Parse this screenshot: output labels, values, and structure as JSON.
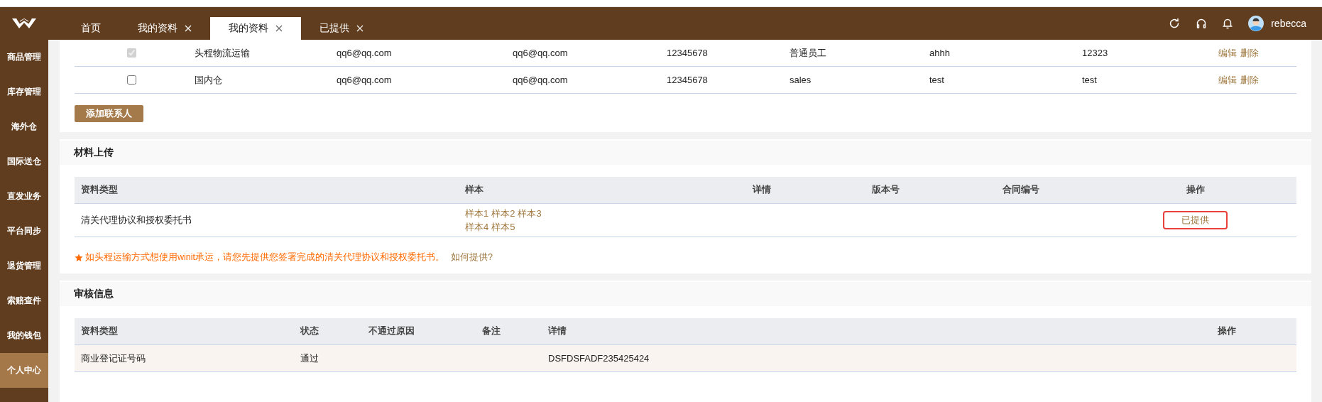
{
  "header": {
    "tabs": [
      {
        "label": "首页",
        "closable": false,
        "selected": false
      },
      {
        "label": "我的资料",
        "closable": true,
        "selected": false
      },
      {
        "label": "我的资料",
        "closable": true,
        "selected": true
      },
      {
        "label": "已提供",
        "closable": true,
        "selected": false
      }
    ],
    "username": "rebecca"
  },
  "sidebar": {
    "items": [
      {
        "label": "商品管理",
        "selected": false
      },
      {
        "label": "库存管理",
        "selected": false
      },
      {
        "label": "海外仓",
        "selected": false
      },
      {
        "label": "国际送仓",
        "selected": false
      },
      {
        "label": "直发业务",
        "selected": false
      },
      {
        "label": "平台同步",
        "selected": false
      },
      {
        "label": "退货管理",
        "selected": false
      },
      {
        "label": "索赔查件",
        "selected": false
      },
      {
        "label": "我的钱包",
        "selected": false
      },
      {
        "label": "个人中心",
        "selected": true
      }
    ]
  },
  "contacts": {
    "rows": [
      {
        "checked": true,
        "disabled": true,
        "cells": [
          "头程物流运输",
          "qq6@qq.com",
          "qq6@qq.com",
          "12345678",
          "普通员工",
          "ahhh",
          "12323"
        ],
        "actions": [
          "编辑",
          "删除"
        ]
      },
      {
        "checked": false,
        "disabled": false,
        "cells": [
          "国内仓",
          "qq6@qq.com",
          "qq6@qq.com",
          "12345678",
          "sales",
          "test",
          "test"
        ],
        "actions": [
          "编辑",
          "删除"
        ]
      }
    ],
    "add_button": "添加联系人"
  },
  "materials": {
    "title": "材料上传",
    "columns": [
      "资料类型",
      "样本",
      "详情",
      "版本号",
      "合同编号",
      "操作"
    ],
    "rows": [
      {
        "type": "清关代理协议和授权委托书",
        "sample_lines": [
          [
            "样本1",
            "样本2",
            "样本3"
          ],
          [
            "样本4",
            "样本5"
          ]
        ],
        "action": "已提供",
        "action_outlined": true
      }
    ],
    "note": "如头程运输方式想使用winit承运，请您先提供您签署完成的清关代理协议和授权委托书。",
    "note_link": "如何提供?"
  },
  "review": {
    "title": "审核信息",
    "columns": [
      "资料类型",
      "状态",
      "不通过原因",
      "备注",
      "详情",
      "操作"
    ],
    "rows": [
      {
        "type": "商业登记证号码",
        "status": "通过",
        "detail": "DSFDSFADF235425424",
        "highlighted": true
      }
    ]
  }
}
